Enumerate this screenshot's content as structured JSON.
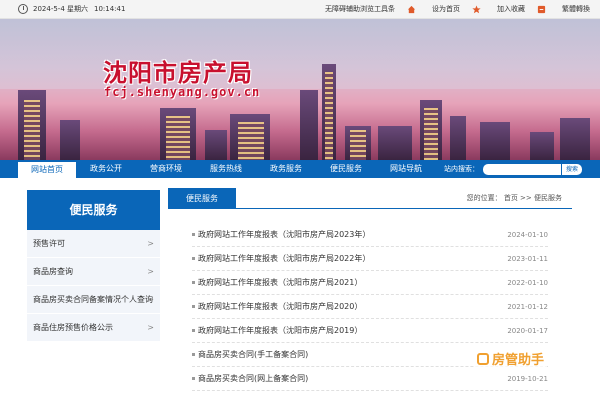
{
  "topbar": {
    "date": "2024-5-4 星期六",
    "time": "10:14:41",
    "accessibility": "无障碍辅助浏览工具条",
    "set_home": "设为首页",
    "favorite": "加入收藏",
    "traditional": "繁體轉換"
  },
  "banner": {
    "title": "沈阳市房产局",
    "url": "fcj.shenyang.gov.cn"
  },
  "nav": {
    "items": [
      "网站首页",
      "政务公开",
      "营商环境",
      "服务热线",
      "政务服务",
      "便民服务",
      "网站导航"
    ],
    "search_label": "站内搜索：",
    "search_button": "搜索"
  },
  "sidebar": {
    "title": "便民服务",
    "items": [
      "预售许可",
      "商品房查询",
      "商品房买卖合同备案情况个人查询",
      "商品住房预售价格公示"
    ]
  },
  "main": {
    "tab": "便民服务",
    "breadcrumb": "您的位置：  首页 >> 便民服务",
    "rows": [
      {
        "title": "政府网站工作年度报表（沈阳市房产局2023年）",
        "date": "2024-01-10"
      },
      {
        "title": "政府网站工作年度报表（沈阳市房产局2022年）",
        "date": "2023-01-11"
      },
      {
        "title": "政府网站工作年度报表（沈阳市房产局2021）",
        "date": "2022-01-10"
      },
      {
        "title": "政府网站工作年度报表（沈阳市房产局2020）",
        "date": "2021-01-12"
      },
      {
        "title": "政府网站工作年度报表（沈阳市房产局2019）",
        "date": "2020-01-17"
      },
      {
        "title": "商品房买卖合同(手工备案合同)",
        "date": ""
      },
      {
        "title": "商品房买卖合同(网上备案合同)",
        "date": "2019-10-21"
      }
    ]
  },
  "watermark": "房管助手",
  "colors": {
    "primary": "#0a66b8",
    "title_red": "#c8102e"
  }
}
